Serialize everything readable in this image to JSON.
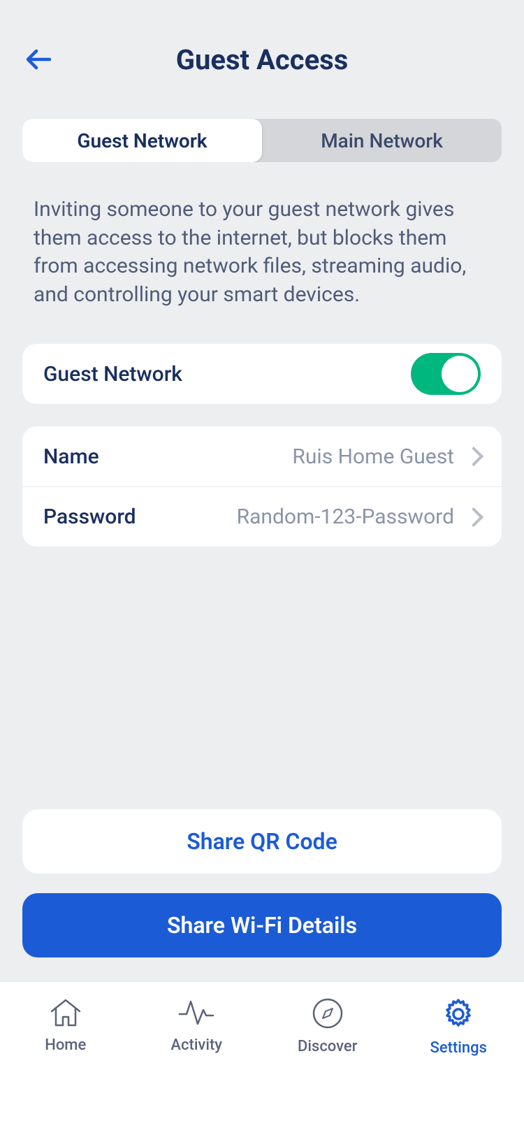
{
  "header": {
    "title": "Guest Access"
  },
  "segmented": {
    "guest_label": "Guest Network",
    "main_label": "Main Network"
  },
  "description": "Inviting someone to your guest network gives them access to the internet, but blocks them from accessing network files, streaming audio, and controlling your smart devices.",
  "guest_toggle": {
    "label": "Guest Network",
    "on": true
  },
  "details": {
    "name_label": "Name",
    "name_value": "Ruis Home Guest",
    "password_label": "Password",
    "password_value": "Random-123-Password"
  },
  "buttons": {
    "share_qr": "Share QR Code",
    "share_wifi": "Share Wi-Fi Details"
  },
  "tabbar": {
    "home": "Home",
    "activity": "Activity",
    "discover": "Discover",
    "settings": "Settings"
  },
  "colors": {
    "accent": "#1b5bd6",
    "text_primary": "#1a2f60",
    "toggle_on": "#00b77e"
  }
}
